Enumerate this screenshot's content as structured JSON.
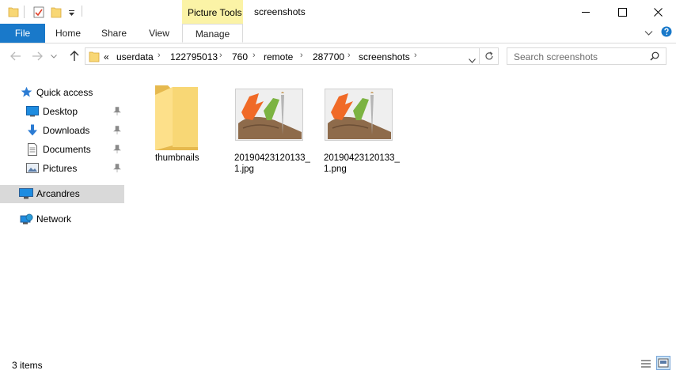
{
  "window": {
    "title": "screenshots",
    "contextual_tab_group": "Picture Tools"
  },
  "ribbon": {
    "tabs": [
      {
        "label": "File"
      },
      {
        "label": "Home"
      },
      {
        "label": "Share"
      },
      {
        "label": "View"
      },
      {
        "label": "Manage"
      }
    ]
  },
  "address": {
    "overflow": "«",
    "crumbs": [
      "userdata",
      "122795013",
      "760",
      "remote",
      "287700",
      "screenshots"
    ]
  },
  "search": {
    "placeholder": "Search screenshots"
  },
  "nav": {
    "quick_access": "Quick access",
    "items": [
      {
        "label": "Desktop",
        "pinned": true
      },
      {
        "label": "Downloads",
        "pinned": true
      },
      {
        "label": "Documents",
        "pinned": true
      },
      {
        "label": "Pictures",
        "pinned": true
      }
    ],
    "this_pc": "Arcandres",
    "network": "Network"
  },
  "files": [
    {
      "name": "thumbnails",
      "kind": "folder"
    },
    {
      "name_line1": "20190423120133_",
      "name_line2": "1.jpg",
      "kind": "image"
    },
    {
      "name_line1": "20190423120133_",
      "name_line2": "1.png",
      "kind": "image"
    }
  ],
  "status": {
    "item_count": "3 items"
  },
  "colors": {
    "file_tab": "#1979ca",
    "picture_tools": "#fbf3a6",
    "folder": "#f8d775",
    "selection": "#d9d9d9"
  }
}
